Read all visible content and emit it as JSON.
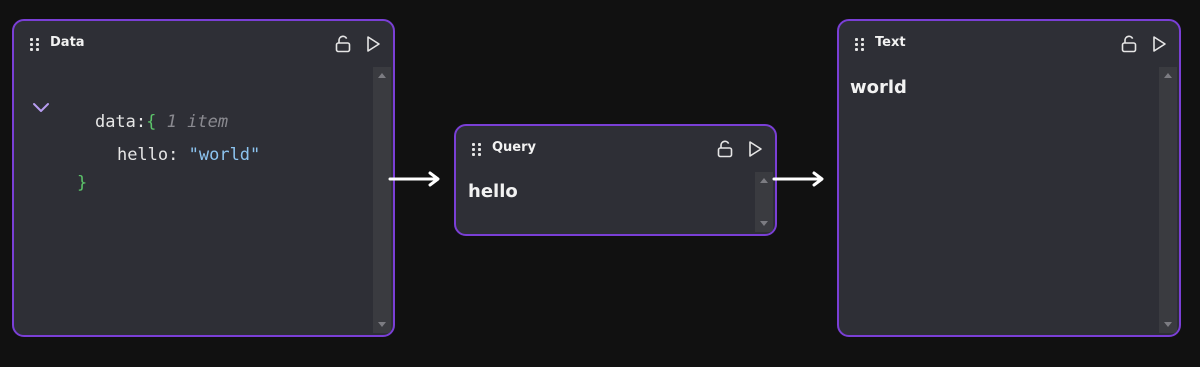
{
  "nodes": {
    "data": {
      "title": "Data",
      "json": {
        "root_key": "data:",
        "open_brace": "{",
        "count": "1 item",
        "entry_key": "hello:",
        "entry_value": "\"world\"",
        "close_brace": "}"
      }
    },
    "query": {
      "title": "Query",
      "value": "hello"
    },
    "text": {
      "title": "Text",
      "value": "world"
    }
  },
  "icons": {
    "drag": "drag-handle-icon",
    "lock": "unlock-icon",
    "run": "play-icon",
    "expand": "chevron-down-icon"
  },
  "colors": {
    "background": "#111111",
    "node_bg": "#2e2f36",
    "node_border": "#7a3fd6",
    "json_brace": "#5cc46a",
    "json_string": "#8cc4f0",
    "chevron": "#b79cf0",
    "edge": "#ffffff"
  }
}
